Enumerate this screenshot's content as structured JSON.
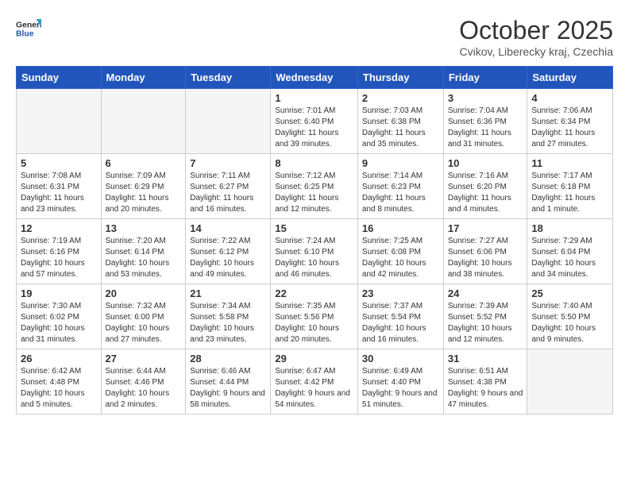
{
  "header": {
    "logo_general": "General",
    "logo_blue": "Blue",
    "month_title": "October 2025",
    "subtitle": "Cvikov, Liberecky kraj, Czechia"
  },
  "days_of_week": [
    "Sunday",
    "Monday",
    "Tuesday",
    "Wednesday",
    "Thursday",
    "Friday",
    "Saturday"
  ],
  "weeks": [
    [
      {
        "day": "",
        "info": ""
      },
      {
        "day": "",
        "info": ""
      },
      {
        "day": "",
        "info": ""
      },
      {
        "day": "1",
        "info": "Sunrise: 7:01 AM\nSunset: 6:40 PM\nDaylight: 11 hours\nand 39 minutes."
      },
      {
        "day": "2",
        "info": "Sunrise: 7:03 AM\nSunset: 6:38 PM\nDaylight: 11 hours\nand 35 minutes."
      },
      {
        "day": "3",
        "info": "Sunrise: 7:04 AM\nSunset: 6:36 PM\nDaylight: 11 hours\nand 31 minutes."
      },
      {
        "day": "4",
        "info": "Sunrise: 7:06 AM\nSunset: 6:34 PM\nDaylight: 11 hours\nand 27 minutes."
      }
    ],
    [
      {
        "day": "5",
        "info": "Sunrise: 7:08 AM\nSunset: 6:31 PM\nDaylight: 11 hours\nand 23 minutes."
      },
      {
        "day": "6",
        "info": "Sunrise: 7:09 AM\nSunset: 6:29 PM\nDaylight: 11 hours\nand 20 minutes."
      },
      {
        "day": "7",
        "info": "Sunrise: 7:11 AM\nSunset: 6:27 PM\nDaylight: 11 hours\nand 16 minutes."
      },
      {
        "day": "8",
        "info": "Sunrise: 7:12 AM\nSunset: 6:25 PM\nDaylight: 11 hours\nand 12 minutes."
      },
      {
        "day": "9",
        "info": "Sunrise: 7:14 AM\nSunset: 6:23 PM\nDaylight: 11 hours\nand 8 minutes."
      },
      {
        "day": "10",
        "info": "Sunrise: 7:16 AM\nSunset: 6:20 PM\nDaylight: 11 hours\nand 4 minutes."
      },
      {
        "day": "11",
        "info": "Sunrise: 7:17 AM\nSunset: 6:18 PM\nDaylight: 11 hours\nand 1 minute."
      }
    ],
    [
      {
        "day": "12",
        "info": "Sunrise: 7:19 AM\nSunset: 6:16 PM\nDaylight: 10 hours\nand 57 minutes."
      },
      {
        "day": "13",
        "info": "Sunrise: 7:20 AM\nSunset: 6:14 PM\nDaylight: 10 hours\nand 53 minutes."
      },
      {
        "day": "14",
        "info": "Sunrise: 7:22 AM\nSunset: 6:12 PM\nDaylight: 10 hours\nand 49 minutes."
      },
      {
        "day": "15",
        "info": "Sunrise: 7:24 AM\nSunset: 6:10 PM\nDaylight: 10 hours\nand 46 minutes."
      },
      {
        "day": "16",
        "info": "Sunrise: 7:25 AM\nSunset: 6:08 PM\nDaylight: 10 hours\nand 42 minutes."
      },
      {
        "day": "17",
        "info": "Sunrise: 7:27 AM\nSunset: 6:06 PM\nDaylight: 10 hours\nand 38 minutes."
      },
      {
        "day": "18",
        "info": "Sunrise: 7:29 AM\nSunset: 6:04 PM\nDaylight: 10 hours\nand 34 minutes."
      }
    ],
    [
      {
        "day": "19",
        "info": "Sunrise: 7:30 AM\nSunset: 6:02 PM\nDaylight: 10 hours\nand 31 minutes."
      },
      {
        "day": "20",
        "info": "Sunrise: 7:32 AM\nSunset: 6:00 PM\nDaylight: 10 hours\nand 27 minutes."
      },
      {
        "day": "21",
        "info": "Sunrise: 7:34 AM\nSunset: 5:58 PM\nDaylight: 10 hours\nand 23 minutes."
      },
      {
        "day": "22",
        "info": "Sunrise: 7:35 AM\nSunset: 5:56 PM\nDaylight: 10 hours\nand 20 minutes."
      },
      {
        "day": "23",
        "info": "Sunrise: 7:37 AM\nSunset: 5:54 PM\nDaylight: 10 hours\nand 16 minutes."
      },
      {
        "day": "24",
        "info": "Sunrise: 7:39 AM\nSunset: 5:52 PM\nDaylight: 10 hours\nand 12 minutes."
      },
      {
        "day": "25",
        "info": "Sunrise: 7:40 AM\nSunset: 5:50 PM\nDaylight: 10 hours\nand 9 minutes."
      }
    ],
    [
      {
        "day": "26",
        "info": "Sunrise: 6:42 AM\nSunset: 4:48 PM\nDaylight: 10 hours\nand 5 minutes."
      },
      {
        "day": "27",
        "info": "Sunrise: 6:44 AM\nSunset: 4:46 PM\nDaylight: 10 hours\nand 2 minutes."
      },
      {
        "day": "28",
        "info": "Sunrise: 6:46 AM\nSunset: 4:44 PM\nDaylight: 9 hours\nand 58 minutes."
      },
      {
        "day": "29",
        "info": "Sunrise: 6:47 AM\nSunset: 4:42 PM\nDaylight: 9 hours\nand 54 minutes."
      },
      {
        "day": "30",
        "info": "Sunrise: 6:49 AM\nSunset: 4:40 PM\nDaylight: 9 hours\nand 51 minutes."
      },
      {
        "day": "31",
        "info": "Sunrise: 6:51 AM\nSunset: 4:38 PM\nDaylight: 9 hours\nand 47 minutes."
      },
      {
        "day": "",
        "info": ""
      }
    ]
  ]
}
